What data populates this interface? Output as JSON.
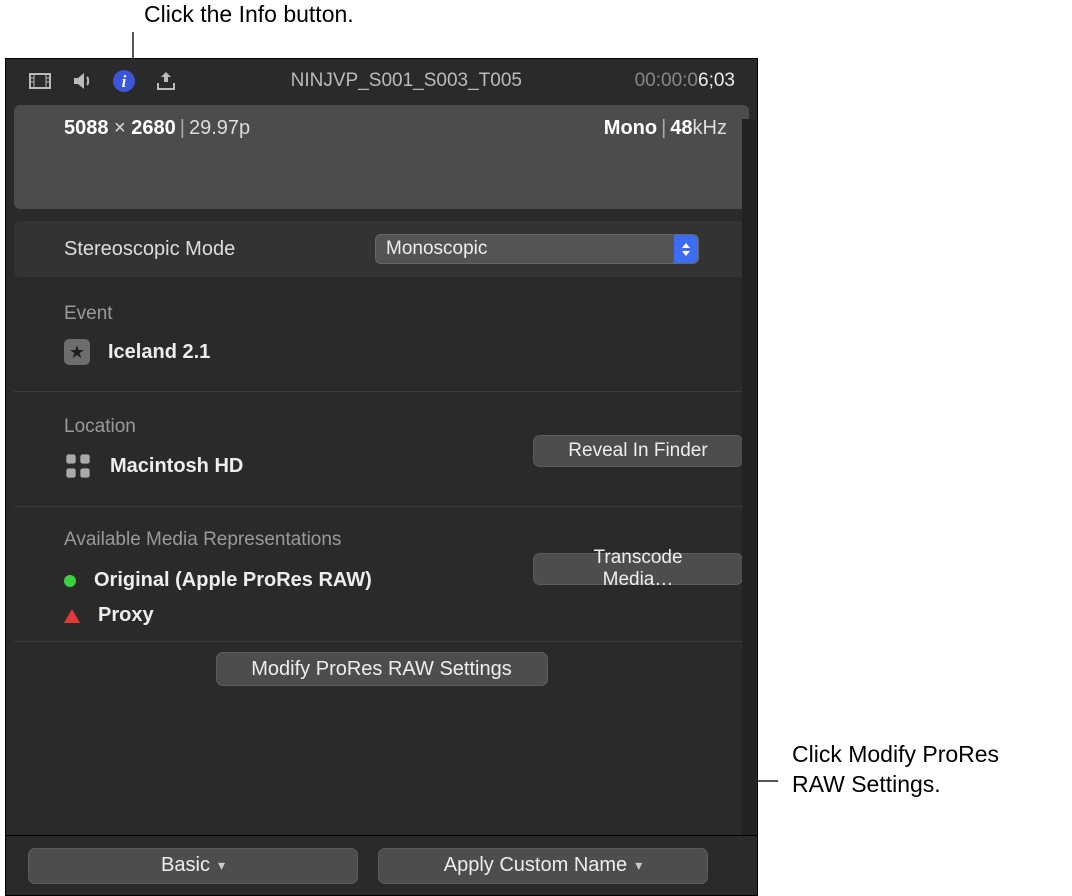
{
  "callouts": {
    "top": "Click the Info button.",
    "right": "Click Modify ProRes RAW Settings."
  },
  "toolbar": {
    "clip_name": "NINJVP_S001_S003_T005",
    "timecode_muted": "00:00:0",
    "timecode_bright": "6;03"
  },
  "summary": {
    "dim_w": "5088",
    "dim_h": "2680",
    "fps": "29.97p",
    "audio_mode": "Mono",
    "audio_rate": "48",
    "audio_unit": "kHz"
  },
  "stereoscopic": {
    "label": "Stereoscopic Mode",
    "value": "Monoscopic"
  },
  "event": {
    "label": "Event",
    "name": "Iceland 2.1"
  },
  "location": {
    "label": "Location",
    "name": "Macintosh HD",
    "reveal": "Reveal In Finder"
  },
  "media": {
    "label": "Available Media Representations",
    "original": "Original (Apple ProRes RAW)",
    "proxy": "Proxy",
    "transcode": "Transcode Media…"
  },
  "modify": {
    "label": "Modify ProRes RAW Settings"
  },
  "bottom": {
    "basic": "Basic",
    "apply": "Apply Custom Name"
  }
}
